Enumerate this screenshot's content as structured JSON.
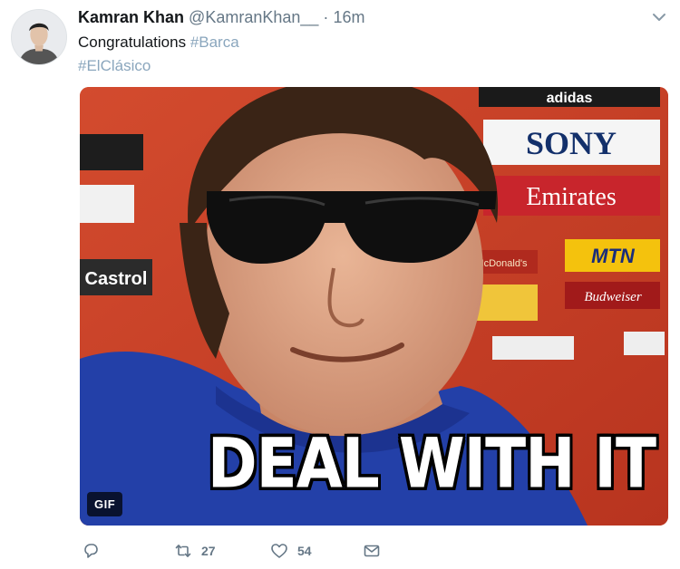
{
  "tweet": {
    "author_name": "Kamran Khan",
    "author_handle": "@KamranKhan__",
    "separator": "·",
    "time": "16m",
    "text_main": "Congratulations",
    "hashtag_1": "#Barca",
    "hashtag_2": "#ElClásico"
  },
  "media": {
    "gif_badge": "GIF",
    "caption": "DEAL WITH IT",
    "sponsor_boards": [
      "adidas",
      "SONY",
      "Emirates",
      "MTN",
      "Budweiser",
      "Castrol",
      "McDonald's"
    ]
  },
  "actions": {
    "retweets": "27",
    "likes": "54"
  },
  "colors": {
    "hashtag": "#8aa6bd",
    "muted": "#657786",
    "gif_background": "#c9442a"
  }
}
